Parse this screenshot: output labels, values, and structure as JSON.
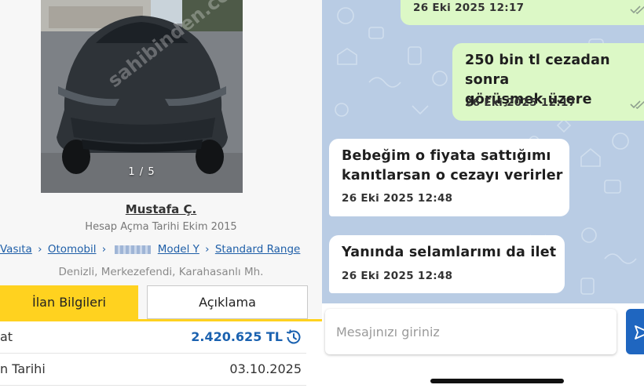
{
  "listing": {
    "photo_counter": "1 / 5",
    "watermark": "sahibinden.com",
    "seller_name": "Mustafa Ç.",
    "seller_since": "Hesap Açma Tarihi  Ekim 2015",
    "breadcrumb": [
      "Vasıta",
      "Otomobil",
      "Model Y",
      "Standard Range"
    ],
    "breadcrumb_sep": "›",
    "location": "Denizli, Merkezefendi, Karahasanlı Mh.",
    "tabs": {
      "info": "İlan Bilgileri",
      "description": "Açıklama"
    },
    "rows": [
      {
        "label": "at",
        "value": "2.420.625 TL"
      },
      {
        "label": "n Tarihi",
        "value": "03.10.2025"
      }
    ],
    "colors": {
      "accent": "#ffd21f",
      "link": "#1f5fa8",
      "price": "#1b62b0"
    }
  },
  "chat": {
    "messages": [
      {
        "direction": "out",
        "text": "",
        "time": "26 Eki 2025 12:17",
        "status": "read"
      },
      {
        "direction": "out",
        "lines": [
          "250 bin tl cezadan sonra",
          "görüşmek üzere"
        ],
        "time": "26 Eki 2025 12:17",
        "status": "read"
      },
      {
        "direction": "in",
        "lines": [
          "Bebeğim o fiyata sattığımı",
          "kanıtlarsan o cezayı verirler"
        ],
        "time": "26 Eki 2025 12:48"
      },
      {
        "direction": "in",
        "lines": [
          "Yanında selamlarımı da ilet"
        ],
        "time": "26 Eki 2025 12:48"
      }
    ],
    "composer_placeholder": "Mesajınızı giriniz",
    "icons": {
      "send": "send-icon",
      "read_status": "double-check-icon"
    },
    "colors": {
      "background": "#b9cce4",
      "outgoing": "#dcf8c6",
      "incoming": "#ffffff",
      "send": "#1f66c0"
    }
  }
}
